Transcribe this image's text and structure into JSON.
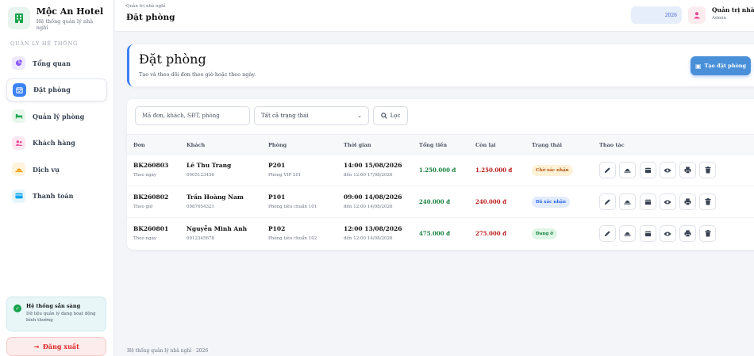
{
  "brand": {
    "name": "Mộc An Hotel",
    "subtitle": "Hệ thống quản lý nhà nghỉ"
  },
  "sidebar": {
    "section_label": "QUẢN LÝ HỆ THỐNG",
    "items": [
      {
        "label": "Tổng quan",
        "icon": "chart-pie-icon",
        "color": "#8b5cf6",
        "bg": "#efe9fe"
      },
      {
        "label": "Đặt phòng",
        "icon": "calendar-icon",
        "color": "#ffffff",
        "bg": "#3b82f6"
      },
      {
        "label": "Quản lý phòng",
        "icon": "bed-icon",
        "color": "#16a34a",
        "bg": "#e7f7ec"
      },
      {
        "label": "Khách hàng",
        "icon": "users-icon",
        "color": "#ec4899",
        "bg": "#fde8f1"
      },
      {
        "label": "Dịch vụ",
        "icon": "service-bell-icon",
        "color": "#f59e0b",
        "bg": "#fef3dd"
      },
      {
        "label": "Thanh toán",
        "icon": "card-icon",
        "color": "#0ea5e9",
        "bg": "#e4f4fb"
      }
    ],
    "status": {
      "title": "Hệ thống sẵn sàng",
      "text": "Dữ liệu quản lý đang hoạt động bình thường"
    },
    "logout_label": "Đăng xuất"
  },
  "topbar": {
    "breadcrumb": "Quản trị nhà nghỉ",
    "title": "Đặt phòng",
    "date_text": "2026",
    "user_name": "Quản trị nhà nghỉ",
    "user_role": "Admin"
  },
  "header": {
    "title": "Đặt phòng",
    "subtitle": "Tạo và theo dõi đơn theo giờ hoặc theo ngày.",
    "add_button": "Tạo đặt phòng"
  },
  "filters": {
    "search_placeholder": "Mã đơn, khách, SĐT, phòng",
    "status_select": "Tất cả trạng thái",
    "filter_button": "Lọc"
  },
  "table": {
    "columns": [
      "Đơn",
      "Khách",
      "Phòng",
      "Thời gian",
      "Tổng tiền",
      "Còn lại",
      "Trạng thái",
      "Thao tác"
    ],
    "rows": [
      {
        "code": "BK260803",
        "mode": "Theo ngày",
        "guest": "Lê Thu Trang",
        "phone": "0905123456",
        "room": "P201",
        "room_type": "Phòng VIP 201",
        "start": "14:00 15/08/2026",
        "end": "đến 12:00 17/08/2026",
        "total": "1.250.000 đ",
        "remaining": "1.250.000 đ",
        "status": "Chờ xác nhận",
        "status_color": "#b45309",
        "status_bg": "#fdf1d8"
      },
      {
        "code": "BK260802",
        "mode": "Theo giờ",
        "guest": "Trần Hoàng Nam",
        "phone": "0987654321",
        "room": "P101",
        "room_type": "Phòng tiêu chuẩn 101",
        "start": "09:00 14/08/2026",
        "end": "đến 12:00 14/08/2026",
        "total": "240.000 đ",
        "remaining": "240.000 đ",
        "status": "Đã xác nhận",
        "status_color": "#2563eb",
        "status_bg": "#e3ecfd"
      },
      {
        "code": "BK260801",
        "mode": "Theo ngày",
        "guest": "Nguyễn Minh Anh",
        "phone": "0912345678",
        "room": "P102",
        "room_type": "Phòng tiêu chuẩn 102",
        "start": "12:00 13/08/2026",
        "end": "đến 12:00 14/08/2026",
        "total": "475.000 đ",
        "remaining": "275.000 đ",
        "status": "Đang ở",
        "status_color": "#15803d",
        "status_bg": "#dff5e6"
      }
    ],
    "action_icons": [
      "edit-icon",
      "check-in-icon",
      "checkout-icon",
      "view-icon",
      "print-icon",
      "delete-icon"
    ]
  },
  "footer": "Hệ thống quản lý nhà nghỉ · 2026",
  "colors": {
    "accent": "#3b82f6",
    "logout": "#dc2626",
    "money_green": "#15803d",
    "money_red": "#b91c1c"
  }
}
